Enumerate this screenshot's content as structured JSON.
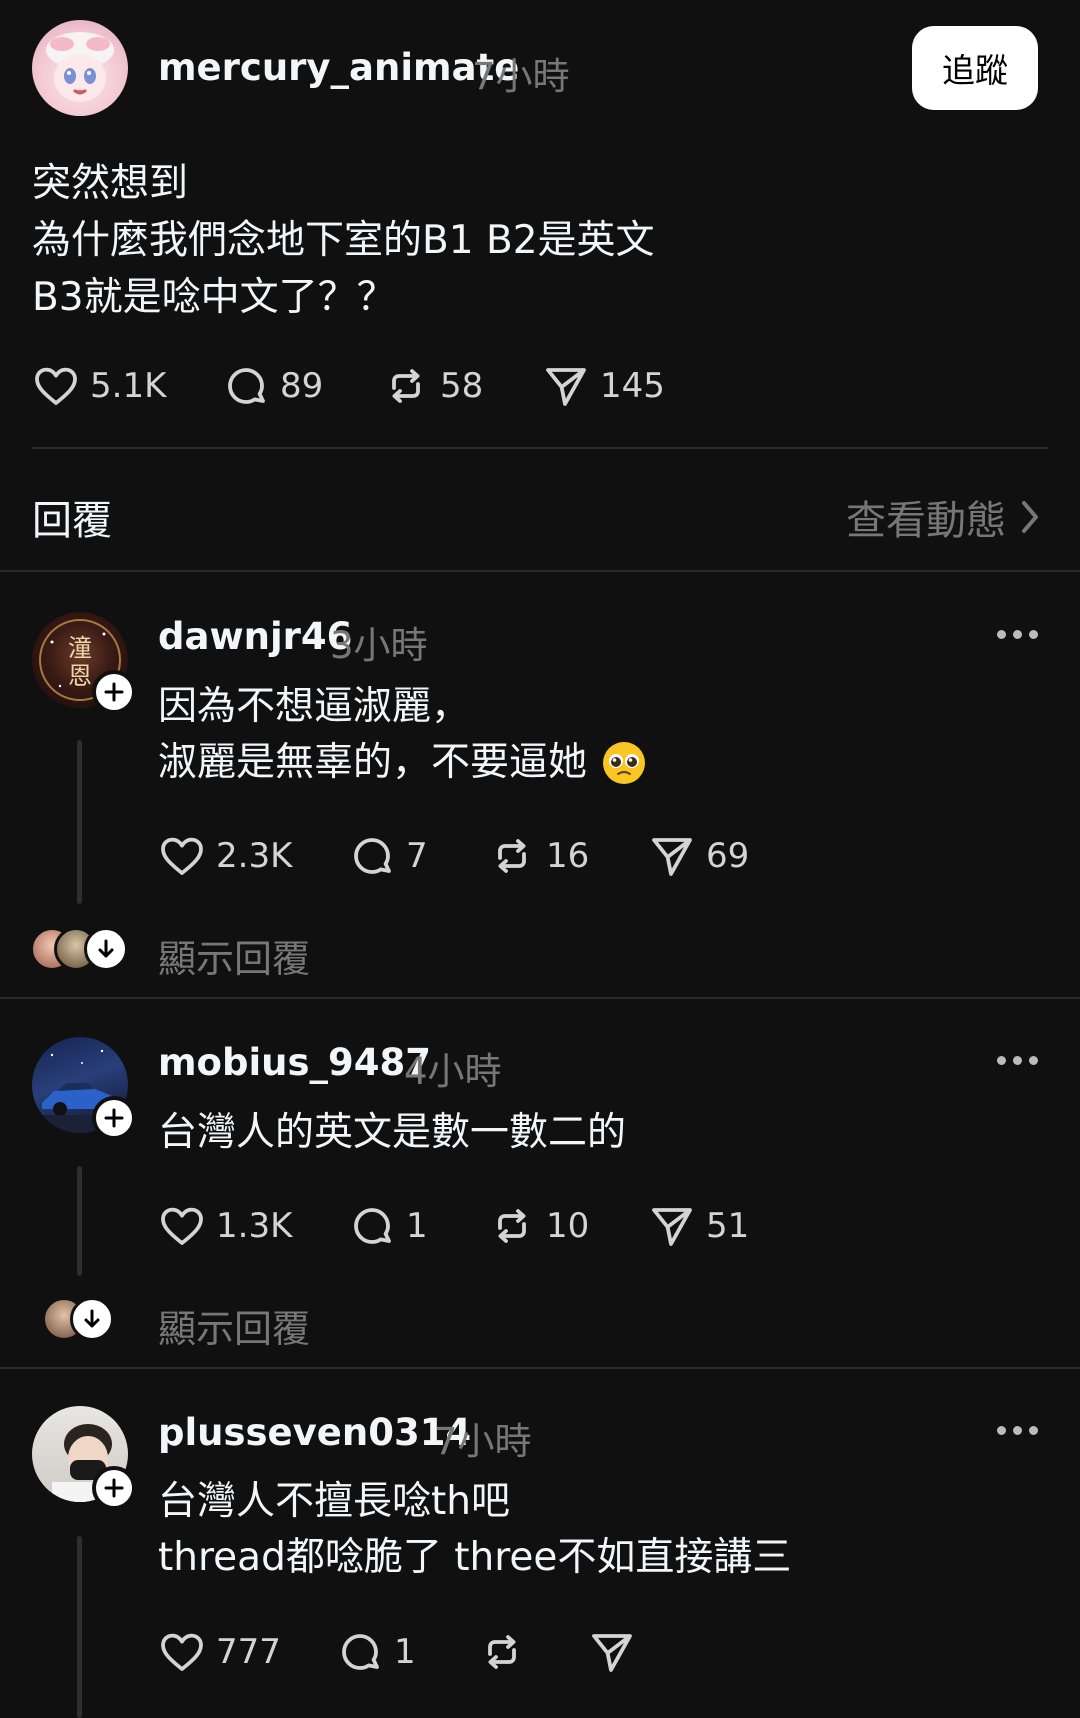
{
  "post": {
    "username": "mercury_animate",
    "time": "7小時",
    "follow_label": "追蹤",
    "lines": [
      "突然想到",
      "為什麼我們念地下室的B1 B2是英文",
      "B3就是唸中文了？？"
    ],
    "likes": "5.1K",
    "comments": "89",
    "reposts": "58",
    "shares": "145"
  },
  "replies_header": {
    "title": "回覆",
    "activity_link": "查看動態"
  },
  "replies": [
    {
      "username": "dawnjr46",
      "time": "3小時",
      "line1": "因為不想逼淑麗，",
      "line2": "淑麗是無辜的，不要逼她",
      "emoji": "🥺",
      "likes": "2.3K",
      "comments": "7",
      "reposts": "16",
      "shares": "69",
      "show_replies": "顯示回覆",
      "avatar_text": [
        "潼",
        "恩"
      ]
    },
    {
      "username": "mobius_9487",
      "time": "4小時",
      "line1": "台灣人的英文是數一數二的",
      "likes": "1.3K",
      "comments": "1",
      "reposts": "10",
      "shares": "51",
      "show_replies": "顯示回覆"
    },
    {
      "username": "plusseven0314",
      "time": "7小時",
      "line1": "台灣人不擅長唸th吧",
      "line2": "thread都唸脆了 three不如直接講三",
      "likes": "777",
      "comments": "1"
    }
  ]
}
